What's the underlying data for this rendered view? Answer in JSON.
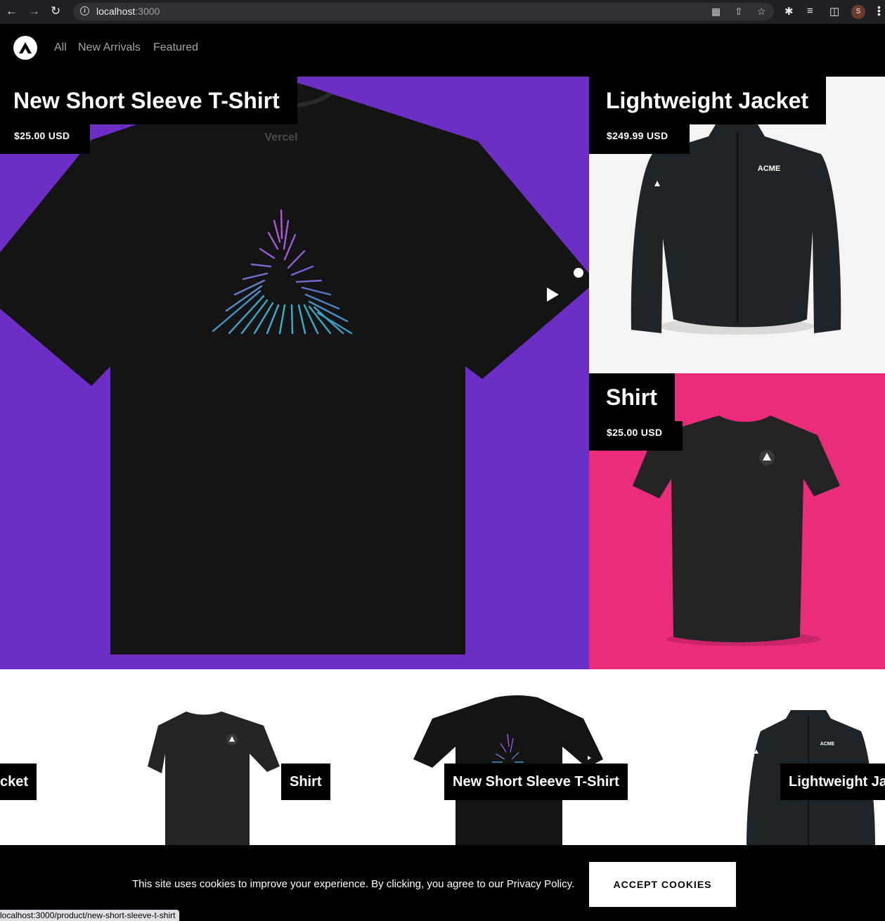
{
  "browser": {
    "url_host": "localhost",
    "url_port": ":3000",
    "profile_initial": "S",
    "icons": [
      "back-icon",
      "forward-icon",
      "reload-icon",
      "info-icon",
      "translate-icon",
      "share-icon",
      "star-icon",
      "extensions-icon",
      "reading-list-icon",
      "side-panel-icon",
      "menu-icon"
    ]
  },
  "nav": {
    "links": [
      "All",
      "New Arrivals",
      "Featured"
    ]
  },
  "hero": {
    "title": "New Short Sleeve T-Shirt",
    "price": "$25.00 USD",
    "print_text": "Vercel",
    "bg": "#6d2ec5"
  },
  "side_top": {
    "title": "Lightweight Jacket",
    "price": "$249.99 USD",
    "print_text": "ACME",
    "bg": "#f4f4f4"
  },
  "side_bottom": {
    "title": "Shirt",
    "price": "$25.00 USD",
    "bg": "#ea2c7b"
  },
  "carousel": {
    "items": [
      "cket",
      "Shirt",
      "New Short Sleeve T-Shirt",
      "Lightweight Ja"
    ],
    "print_text": "ACME"
  },
  "cookie": {
    "text": "This site uses cookies to improve your experience. By clicking, you agree to our Privacy Policy.",
    "button": "ACCEPT COOKIES"
  },
  "status_bar": {
    "url": "localhost:3000/product/new-short-sleeve-t-shirt"
  }
}
